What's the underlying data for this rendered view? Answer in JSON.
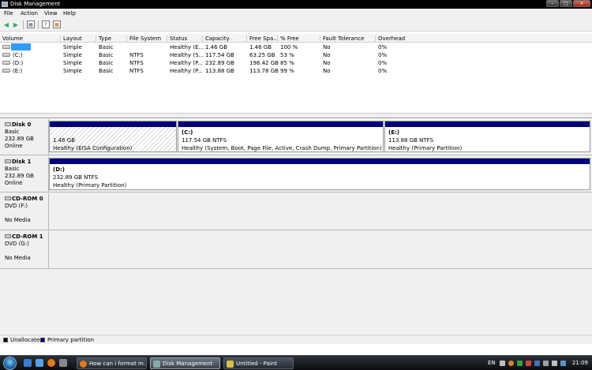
{
  "window": {
    "title": "Disk Management"
  },
  "menu": [
    "File",
    "Action",
    "View",
    "Help"
  ],
  "toolbar_icons": [
    "back-icon",
    "forward-icon",
    "console-tree-icon",
    "help-icon",
    "properties-icon"
  ],
  "volume_table": {
    "columns": [
      "Volume",
      "Layout",
      "Type",
      "File System",
      "Status",
      "Capacity",
      "Free Spa...",
      "% Free",
      "Fault Tolerance",
      "Overhead"
    ],
    "rows": [
      {
        "volume": "",
        "layout": "Simple",
        "type": "Basic",
        "fs": "",
        "status": "Healthy (E...",
        "capacity": "1.46 GB",
        "free": "1.46 GB",
        "pct": "100 %",
        "fault": "No",
        "overhead": "0%",
        "selected": true
      },
      {
        "volume": "(C:)",
        "layout": "Simple",
        "type": "Basic",
        "fs": "NTFS",
        "status": "Healthy (S...",
        "capacity": "117.54 GB",
        "free": "63.25 GB",
        "pct": "53 %",
        "fault": "No",
        "overhead": "0%"
      },
      {
        "volume": "(D:)",
        "layout": "Simple",
        "type": "Basic",
        "fs": "NTFS",
        "status": "Healthy (P...",
        "capacity": "232.89 GB",
        "free": "198.42 GB",
        "pct": "85 %",
        "fault": "No",
        "overhead": "0%"
      },
      {
        "volume": "(E:)",
        "layout": "Simple",
        "type": "Basic",
        "fs": "NTFS",
        "status": "Healthy (P...",
        "capacity": "113.88 GB",
        "free": "113.78 GB",
        "pct": "99 %",
        "fault": "No",
        "overhead": "0%"
      }
    ]
  },
  "disks": [
    {
      "name": "Disk 0",
      "type": "Basic",
      "size": "232.89 GB",
      "state": "Online",
      "partitions": [
        {
          "title": "",
          "line1": "1.46 GB",
          "line2": "Healthy (EISA Configuration)"
        },
        {
          "title": "(C:)",
          "line1": "117.54 GB NTFS",
          "line2": "Healthy (System, Boot, Page File, Active, Crash Dump, Primary Partition)"
        },
        {
          "title": "(E:)",
          "line1": "113.88 GB NTFS",
          "line2": "Healthy (Primary Partition)"
        }
      ]
    },
    {
      "name": "Disk 1",
      "type": "Basic",
      "size": "232.89 GB",
      "state": "Online",
      "partitions": [
        {
          "title": "(D:)",
          "line1": "232.89 GB NTFS",
          "line2": "Healthy (Primary Partition)"
        }
      ]
    },
    {
      "name": "CD-ROM 0",
      "type": "DVD (F:)",
      "size": "",
      "state": "No Media"
    },
    {
      "name": "CD-ROM 1",
      "type": "DVD (G:)",
      "size": "",
      "state": "No Media"
    }
  ],
  "legend": [
    {
      "label": "Unallocated",
      "color": "#000000"
    },
    {
      "label": "Primary partition",
      "color": "#00007f"
    }
  ],
  "taskbar": {
    "tasks": [
      "How can i format m...",
      "Disk Management",
      "Untitled - Paint"
    ],
    "active_task": "Disk Management",
    "language": "EN",
    "clock": "21:09"
  }
}
